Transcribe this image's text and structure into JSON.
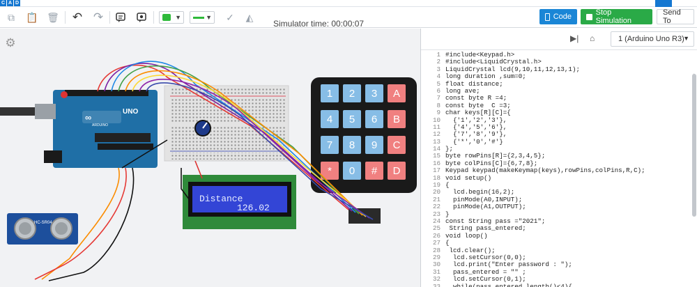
{
  "brand": {
    "letters": [
      "C",
      "A",
      "D"
    ]
  },
  "toolbar": {
    "sim_time": "Simulator time: 00:00:07",
    "code_label": "Code",
    "stop_label": "Stop Simulation",
    "send_label": "Send To",
    "fill_color": "#2fba3a",
    "line_color": "#2fba3a"
  },
  "canvas": {
    "lcd_line1": "Distance",
    "lcd_line2": "126.02",
    "keypad_keys": [
      "1",
      "2",
      "3",
      "A",
      "4",
      "5",
      "6",
      "B",
      "7",
      "8",
      "9",
      "C",
      "*",
      "0",
      "#",
      "D"
    ],
    "arduino_label": "UNO",
    "arduino_brand": "ARDUINO",
    "sensor_label": "HC-SR04"
  },
  "code_panel": {
    "board": "1 (Arduino Uno R3)",
    "line_numbers": [
      "1",
      "2",
      "3",
      "4",
      "5",
      "6",
      "7",
      "8",
      "9",
      "10",
      "11",
      "12",
      "13",
      "14",
      "15",
      "16",
      "17",
      "18",
      "19",
      "20",
      "21",
      "22",
      "23",
      "24",
      "25",
      "26",
      "27",
      "28",
      "29",
      "30",
      "31",
      "32",
      "33"
    ],
    "lines": [
      "#include<Keypad.h>",
      "#include<LiquidCrystal.h>",
      "LiquidCrystal lcd(9,10,11,12,13,1);",
      "long duration ,sum=0;",
      "float distance;",
      "long ave;",
      "const byte R =4;",
      "const byte  C =3;",
      "char keys[R][C]={",
      "  {'1','2','3'},",
      "  {'4','5','6'},",
      "  {'7','8','9'},",
      "  {'*','0','#'}",
      "};",
      "byte rowPins[R]={2,3,4,5};",
      "byte colPins[C]={6,7,8};",
      "Keypad keypad(makeKeymap(keys),rowPins,colPins,R,C);",
      "void setup()",
      "{",
      "  lcd.begin(16,2);",
      "  pinMode(A0,INPUT);",
      "  pinMode(A1,OUTPUT);",
      "}",
      "const String pass =\"2021\";",
      " String pass_entered;",
      "void loop()",
      "{",
      " lcd.clear();",
      "  lcd.setCursor(0,0);",
      "  lcd.print(\"Enter password : \");",
      "  pass_entered = \"\" ;",
      "  lcd.setCursor(0,1);",
      "  while(pass_entered.length()<4){"
    ]
  }
}
